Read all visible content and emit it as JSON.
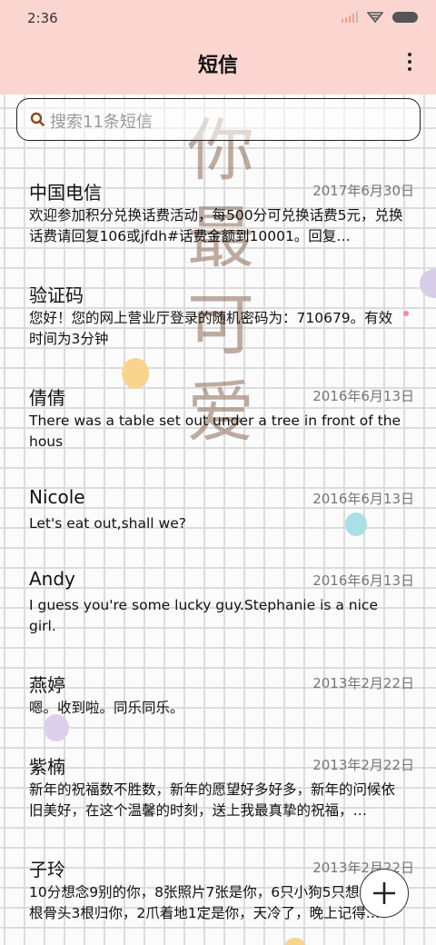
{
  "status_bar": {
    "time": "2:36"
  },
  "header": {
    "title": "短信"
  },
  "search": {
    "placeholder": "搜索11条短信"
  },
  "watermark": [
    "你",
    "最",
    "可",
    "爱"
  ],
  "messages": [
    {
      "sender": "中国电信",
      "date": "2017年6月30日",
      "snippet": "欢迎参加积分兑换话费活动，每500分可兑换话费5元，兑换话费请回复106或jfdh#话费金额到10001。回复…"
    },
    {
      "sender": "验证码",
      "date": "",
      "snippet": "您好！您的网上营业厅登录的随机密码为：710679。有效时间为3分钟"
    },
    {
      "sender": "倩倩",
      "date": "2016年6月13日",
      "snippet": "There was a table set out under a tree in front of the hous"
    },
    {
      "sender": "Nicole",
      "date": "2016年6月13日",
      "snippet": "Let's eat out,shall we?"
    },
    {
      "sender": "Andy",
      "date": "2016年6月13日",
      "snippet": "I guess you're some lucky guy.Stephanie is a nice girl."
    },
    {
      "sender": "燕婷",
      "date": "2013年2月22日",
      "snippet": "嗯。收到啦。同乐同乐。"
    },
    {
      "sender": "紫楠",
      "date": "2013年2月22日",
      "snippet": "新年的祝福数不胜数，新年的愿望好多好多，新年的问候依旧美好，在这个温馨的时刻，送上我最真挚的祝福，…"
    },
    {
      "sender": "子玲",
      "date": "2013年2月22日",
      "snippet": "10分想念9别的你，8张照片7张是你，6只小狗5只想你，4根骨头3根归你，2爪着地1定是你，天冷了，晚上记得…"
    }
  ],
  "colors": {
    "header_bg": "#fbd6d0",
    "accent": "#c0392b"
  }
}
